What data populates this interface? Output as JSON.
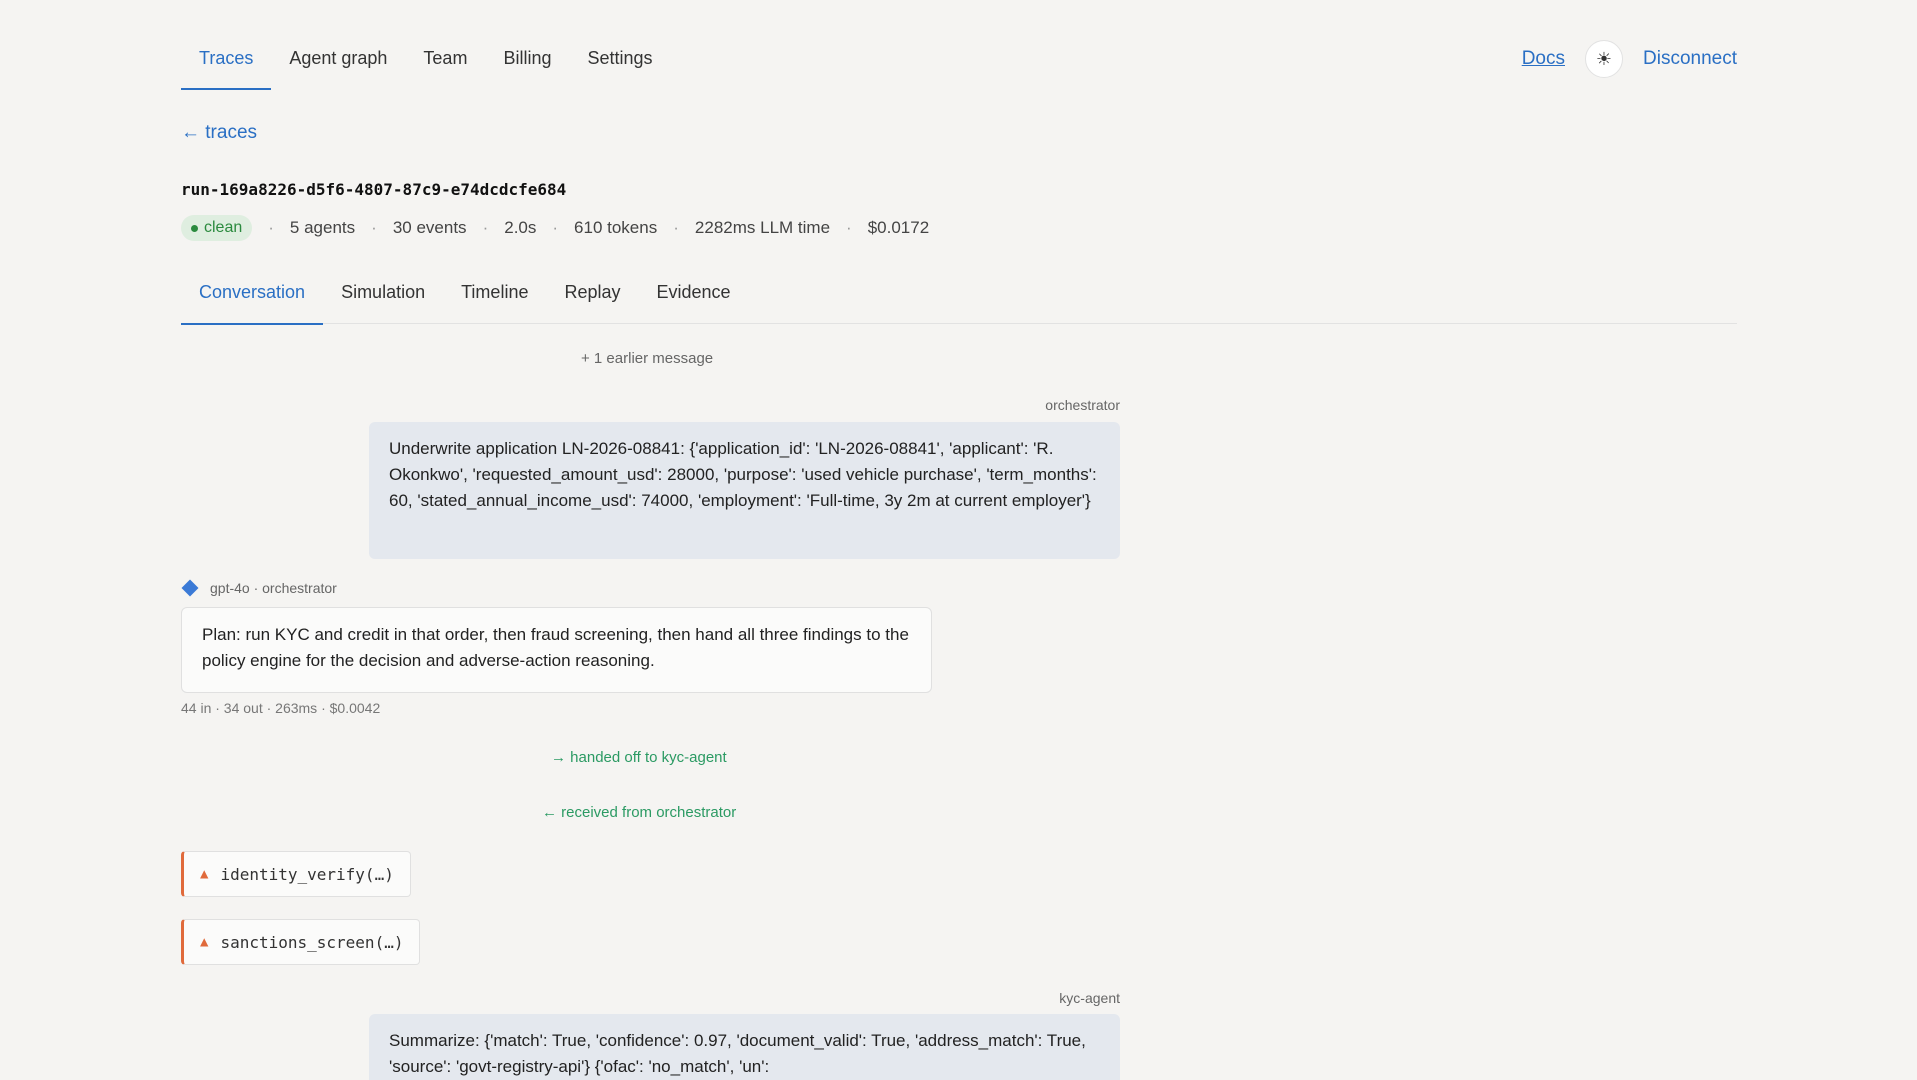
{
  "topnav": {
    "tabs": [
      {
        "label": "Traces",
        "active": true
      },
      {
        "label": "Agent graph",
        "active": false
      },
      {
        "label": "Team",
        "active": false
      },
      {
        "label": "Billing",
        "active": false
      },
      {
        "label": "Settings",
        "active": false
      }
    ],
    "docs_label": "Docs",
    "theme_icon": "☀",
    "disconnect_label": "Disconnect"
  },
  "back": {
    "label": "← traces"
  },
  "run": {
    "id": "run-169a8226-d5f6-4807-87c9-e74dcdcfe684",
    "status": "clean",
    "agents": "5 agents",
    "events": "30 events",
    "duration": "2.0s",
    "tokens": "610 tokens",
    "llm_time": "2282ms LLM time",
    "cost": "$0.0172",
    "separator": "·"
  },
  "subtabs": [
    {
      "label": "Conversation",
      "active": true
    },
    {
      "label": "Simulation",
      "active": false
    },
    {
      "label": "Timeline",
      "active": false
    },
    {
      "label": "Replay",
      "active": false
    },
    {
      "label": "Evidence",
      "active": false
    }
  ],
  "conversation": {
    "earlier_label": "+ 1 earlier message",
    "msg1": {
      "sender": "orchestrator",
      "text": "Underwrite application LN-2026-08841: {'application_id': 'LN-2026-08841', 'applicant': 'R. Okonkwo', 'requested_amount_usd': 28000, 'purpose': 'used vehicle purchase', 'term_months': 60, 'stated_annual_income_usd': 74000, 'employment': 'Full-time, 3y 2m at current employer'}"
    },
    "msg2": {
      "model_line": "gpt-4o · orchestrator",
      "text": "Plan: run KYC and credit in that order, then fraud screening, then hand all three findings to the policy engine for the decision and adverse-action reasoning.",
      "stats": "44 in · 34 out · 263ms · $0.0042"
    },
    "handoff_out": "→ handed off to kyc-agent",
    "handoff_in": "← received from orchestrator",
    "tool_calls": [
      {
        "icon": "▲",
        "label": "identity_verify(…)"
      },
      {
        "icon": "▲",
        "label": "sanctions_screen(…)"
      }
    ],
    "msg3": {
      "sender": "kyc-agent",
      "text": "Summarize: {'match': True, 'confidence': 0.97, 'document_valid': True, 'address_match': True, 'source': 'govt-registry-api'} {'ofac': 'no_match', 'un':"
    }
  }
}
